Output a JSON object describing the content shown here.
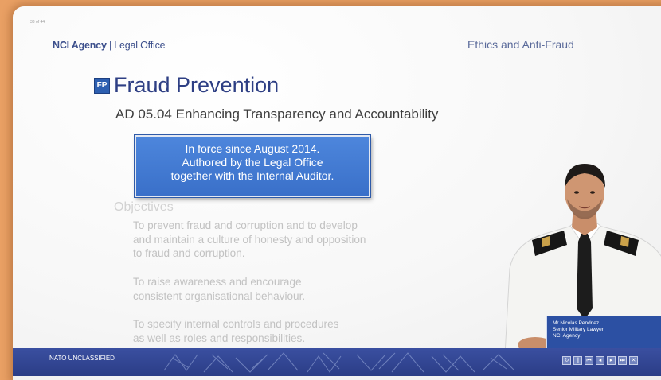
{
  "slide": {
    "counter": "33 of 44",
    "header": {
      "org": "NCI Agency",
      "separator": " | ",
      "dept": "Legal Office",
      "section": "Ethics  and Anti-Fraud"
    },
    "title_logo": "FP",
    "title": "Fraud Prevention",
    "subtitle": "AD 05.04 Enhancing Transparency and Accountability",
    "callout_lines": [
      "In force since August 2014.",
      "Authored by the Legal Office",
      "together with the Internal Auditor."
    ],
    "objectives_heading": "Objectives",
    "objectives": [
      [
        "To prevent fraud and corruption and to develop",
        "and maintain a culture of honesty and opposition",
        "to fraud and corruption."
      ],
      [
        "To raise awareness and encourage",
        "consistent organisational behaviour."
      ],
      [
        "To specify internal controls and procedures",
        "as well as roles and responsibilities."
      ]
    ],
    "presenter_caption": [
      "Mr Nicolas Pendriez",
      "Senior Military Lawyer",
      "NCI Agency"
    ],
    "footer": {
      "classification": "NATO UNCLASSIFIED"
    }
  },
  "player_controls": [
    "replay-icon",
    "pause-icon",
    "first-slide-icon",
    "previous-icon",
    "next-icon",
    "last-slide-icon",
    "close-icon"
  ],
  "colors": {
    "accent": "#2e3f84",
    "callout": "#3f78d2",
    "footer": "#2f4291",
    "frame": "#e9a064"
  }
}
